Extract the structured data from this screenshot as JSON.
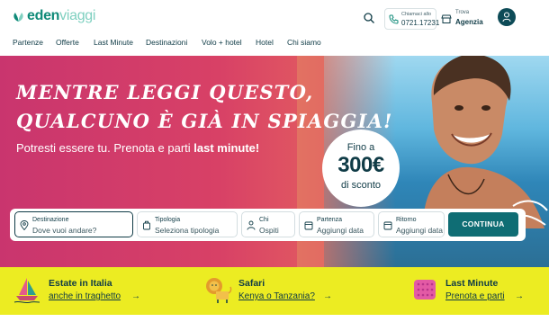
{
  "brand": {
    "eden": "eden",
    "viaggi": "viaggi"
  },
  "header": {
    "call_label": "Chiamaci allo",
    "call_number": "0721.17231",
    "agency_label": "Trova",
    "agency_value": "Agenzia"
  },
  "nav": [
    "Partenze",
    "Offerte",
    "Last Minute",
    "Destinazioni",
    "Volo + hotel",
    "Hotel",
    "Chi siamo"
  ],
  "hero": {
    "title_line1": "MENTRE LEGGI QUESTO,",
    "title_line2": "QUALCUNO È GIÀ IN SPIAGGIA!",
    "subtitle_plain": "Potresti essere tu. Prenota e parti ",
    "subtitle_bold": "last minute!",
    "promo_pre": "Fino a",
    "promo_value": "300€",
    "promo_post": "di sconto"
  },
  "search": {
    "destination": {
      "label": "Destinazione",
      "value": "Dove vuoi andare?"
    },
    "type": {
      "label": "Tipologia",
      "value": "Seleziona tipologia"
    },
    "guests": {
      "label": "Chi",
      "value": "Ospiti"
    },
    "departure": {
      "label": "Partenza",
      "value": "Aggiungi data"
    },
    "return": {
      "label": "Ritorno",
      "value": "Aggiungi data"
    },
    "continue_label": "CONTINUA"
  },
  "strip": [
    {
      "title": "Estate in Italia",
      "link": "anche in traghetto",
      "icon": "sailboat-icon"
    },
    {
      "title": "Safari",
      "link": "Kenya o Tanzania?",
      "icon": "lion-icon"
    },
    {
      "title": "Last Minute",
      "link": "Prenota e parti",
      "icon": "beach-towel-icon"
    }
  ],
  "colors": {
    "teal": "#0f8a78",
    "dark": "#0f3b46",
    "hero_start": "#c9356e",
    "hero_end": "#e98a6f",
    "strip": "#ecec22",
    "button": "#0f6d74"
  }
}
